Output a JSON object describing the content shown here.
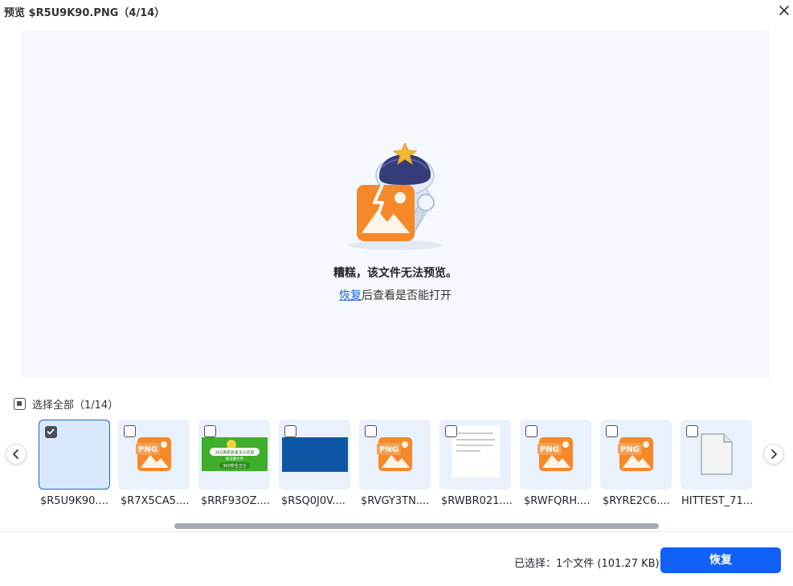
{
  "window": {
    "title": "预览 $R5U9K90.PNG（4/14）"
  },
  "preview": {
    "error_title": "糟糕，该文件无法预览。",
    "error_link": "恢复",
    "error_rest": "后查看是否能打开"
  },
  "selection": {
    "select_all_label": "选择全部（1/14）"
  },
  "thumbnails": [
    {
      "name": "$R5U9K90....",
      "checked": true,
      "kind": "blank"
    },
    {
      "name": "$R7X5CA5....",
      "checked": false,
      "kind": "png-icon",
      "badge": "PNG"
    },
    {
      "name": "$RRF93OZ....",
      "checked": false,
      "kind": "green-banner",
      "lines": [
        "360满意收录怎么恢复",
        "被误删文件",
        "360安全卫士"
      ]
    },
    {
      "name": "$RSQ0J0V....",
      "checked": false,
      "kind": "blue-screen"
    },
    {
      "name": "$RVGY3TN....",
      "checked": false,
      "kind": "png-icon",
      "badge": "PNG"
    },
    {
      "name": "$RWBR021....",
      "checked": false,
      "kind": "doc"
    },
    {
      "name": "$RWFQRH....",
      "checked": false,
      "kind": "png-icon",
      "badge": "PNG"
    },
    {
      "name": "$RYRE2C6....",
      "checked": false,
      "kind": "png-icon",
      "badge": "PNG"
    },
    {
      "name": "HITTEST_71...",
      "checked": false,
      "kind": "file-icon"
    }
  ],
  "footer": {
    "status": "已选择：1个文件 (101.27 KB)",
    "recover_label": "恢复"
  },
  "colors": {
    "accent": "#1160f7",
    "link": "#1a66d6",
    "icon_orange": "#f5892a",
    "preview_bg": "#f5f9ff"
  }
}
